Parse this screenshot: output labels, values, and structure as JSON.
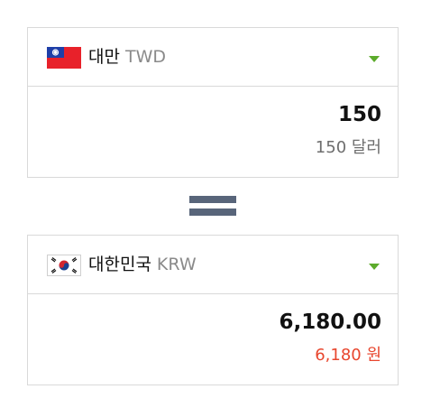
{
  "from": {
    "country": "대만",
    "code": "TWD",
    "flag": "taiwan-flag-icon",
    "amount": "150",
    "amount_words": "150 달러"
  },
  "to": {
    "country": "대한민국",
    "code": "KRW",
    "flag": "south-korea-flag-icon",
    "amount": "6,180.00",
    "amount_words": "6,180 원"
  },
  "colors": {
    "caret": "#5cab2b",
    "equals": "#58657a",
    "result_words": "#e8462e",
    "border": "#d9d9d9"
  }
}
